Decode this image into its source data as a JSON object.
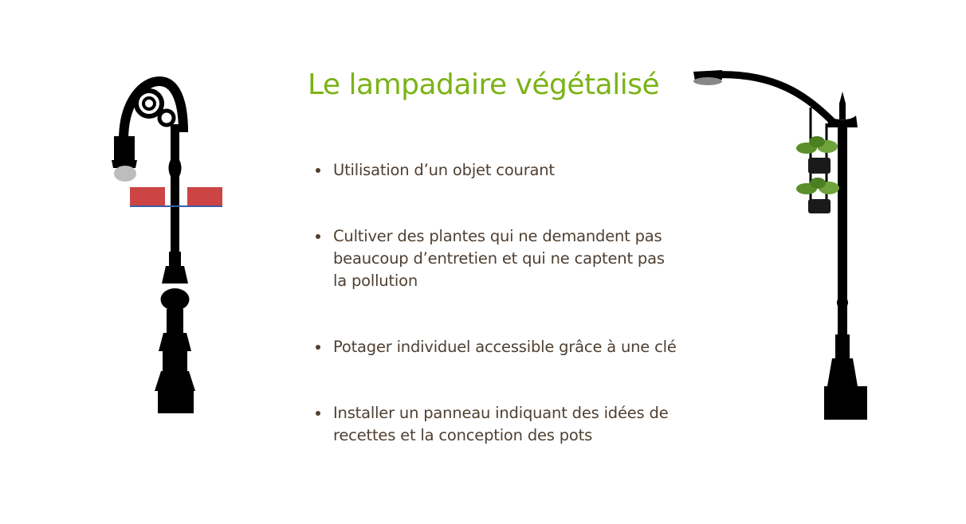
{
  "slide": {
    "title": "Le lampadaire végétalisé",
    "bullets": [
      "Utilisation d’un objet courant",
      "Cultiver des plantes qui ne demandent pas beaucoup d’entretien et qui ne captent pas la pollution",
      "Potager individuel accessible grâce à une clé",
      "Installer un panneau indiquant des idées de recettes et  la conception des pots"
    ]
  },
  "colors": {
    "title": "#7ab317",
    "text": "#4f3f31",
    "lamp": "#000000",
    "sign": "#cc4444",
    "sign_line": "#3a5fa8",
    "plant": "#5a8f2a"
  },
  "icons": {
    "left_image": "ornate-lamppost-illustration",
    "right_image": "lamppost-with-hanging-plants-illustration"
  }
}
